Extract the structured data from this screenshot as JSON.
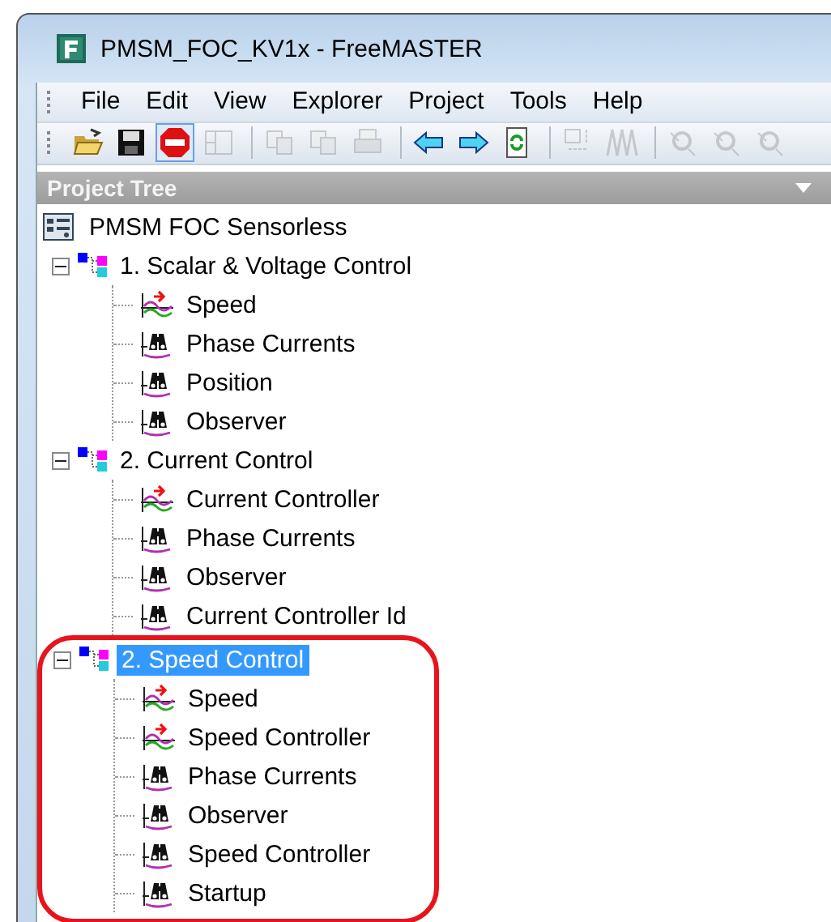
{
  "window": {
    "title": "PMSM_FOC_KV1x - FreeMASTER"
  },
  "menu": [
    {
      "label": "File"
    },
    {
      "label": "Edit"
    },
    {
      "label": "View"
    },
    {
      "label": "Explorer"
    },
    {
      "label": "Project"
    },
    {
      "label": "Tools"
    },
    {
      "label": "Help"
    }
  ],
  "toolbar": [
    [
      {
        "kind": "open",
        "disabled": false,
        "pressed": false
      },
      {
        "kind": "save",
        "disabled": false,
        "pressed": false
      },
      {
        "kind": "stop",
        "disabled": false,
        "pressed": true
      },
      {
        "kind": "layout",
        "disabled": true,
        "pressed": false
      }
    ],
    [
      {
        "kind": "copy",
        "disabled": true,
        "pressed": false
      },
      {
        "kind": "paste",
        "disabled": true,
        "pressed": false
      },
      {
        "kind": "print",
        "disabled": true,
        "pressed": false
      }
    ],
    [
      {
        "kind": "back",
        "disabled": false,
        "pressed": false
      },
      {
        "kind": "forward",
        "disabled": false,
        "pressed": false
      },
      {
        "kind": "refresh",
        "disabled": false,
        "pressed": false
      }
    ],
    [
      {
        "kind": "variable",
        "disabled": true,
        "pressed": false
      },
      {
        "kind": "wave",
        "disabled": true,
        "pressed": false
      }
    ],
    [
      {
        "kind": "probe",
        "disabled": true,
        "pressed": false
      },
      {
        "kind": "probe",
        "disabled": true,
        "pressed": false
      },
      {
        "kind": "probe",
        "disabled": true,
        "pressed": false
      }
    ]
  ],
  "panel": {
    "title": "Project Tree"
  },
  "tree": {
    "label": "PMSM FOC Sensorless",
    "children": [
      {
        "label": "1. Scalar & Voltage Control",
        "expanded": true,
        "selected": false,
        "highlighted": false,
        "children": [
          {
            "label": "Speed",
            "kind": "scope",
            "selected": false
          },
          {
            "label": "Phase Currents",
            "kind": "recorder",
            "selected": false
          },
          {
            "label": "Position",
            "kind": "recorder",
            "selected": false
          },
          {
            "label": "Observer",
            "kind": "recorder",
            "selected": false
          }
        ]
      },
      {
        "label": "2. Current Control",
        "expanded": true,
        "selected": false,
        "highlighted": false,
        "children": [
          {
            "label": "Current Controller",
            "kind": "scope",
            "selected": false
          },
          {
            "label": "Phase Currents",
            "kind": "recorder",
            "selected": false
          },
          {
            "label": "Observer",
            "kind": "recorder",
            "selected": false
          },
          {
            "label": "Current Controller Id",
            "kind": "recorder",
            "selected": false
          }
        ]
      },
      {
        "label": "2. Speed Control",
        "expanded": true,
        "selected": true,
        "highlighted": true,
        "children": [
          {
            "label": "Speed",
            "kind": "scope",
            "selected": false
          },
          {
            "label": "Speed Controller",
            "kind": "scope",
            "selected": false
          },
          {
            "label": "Phase Currents",
            "kind": "recorder",
            "selected": false
          },
          {
            "label": "Observer",
            "kind": "recorder",
            "selected": false
          },
          {
            "label": "Speed Controller",
            "kind": "recorder",
            "selected": false
          },
          {
            "label": "Startup",
            "kind": "recorder",
            "selected": false
          }
        ]
      }
    ]
  }
}
